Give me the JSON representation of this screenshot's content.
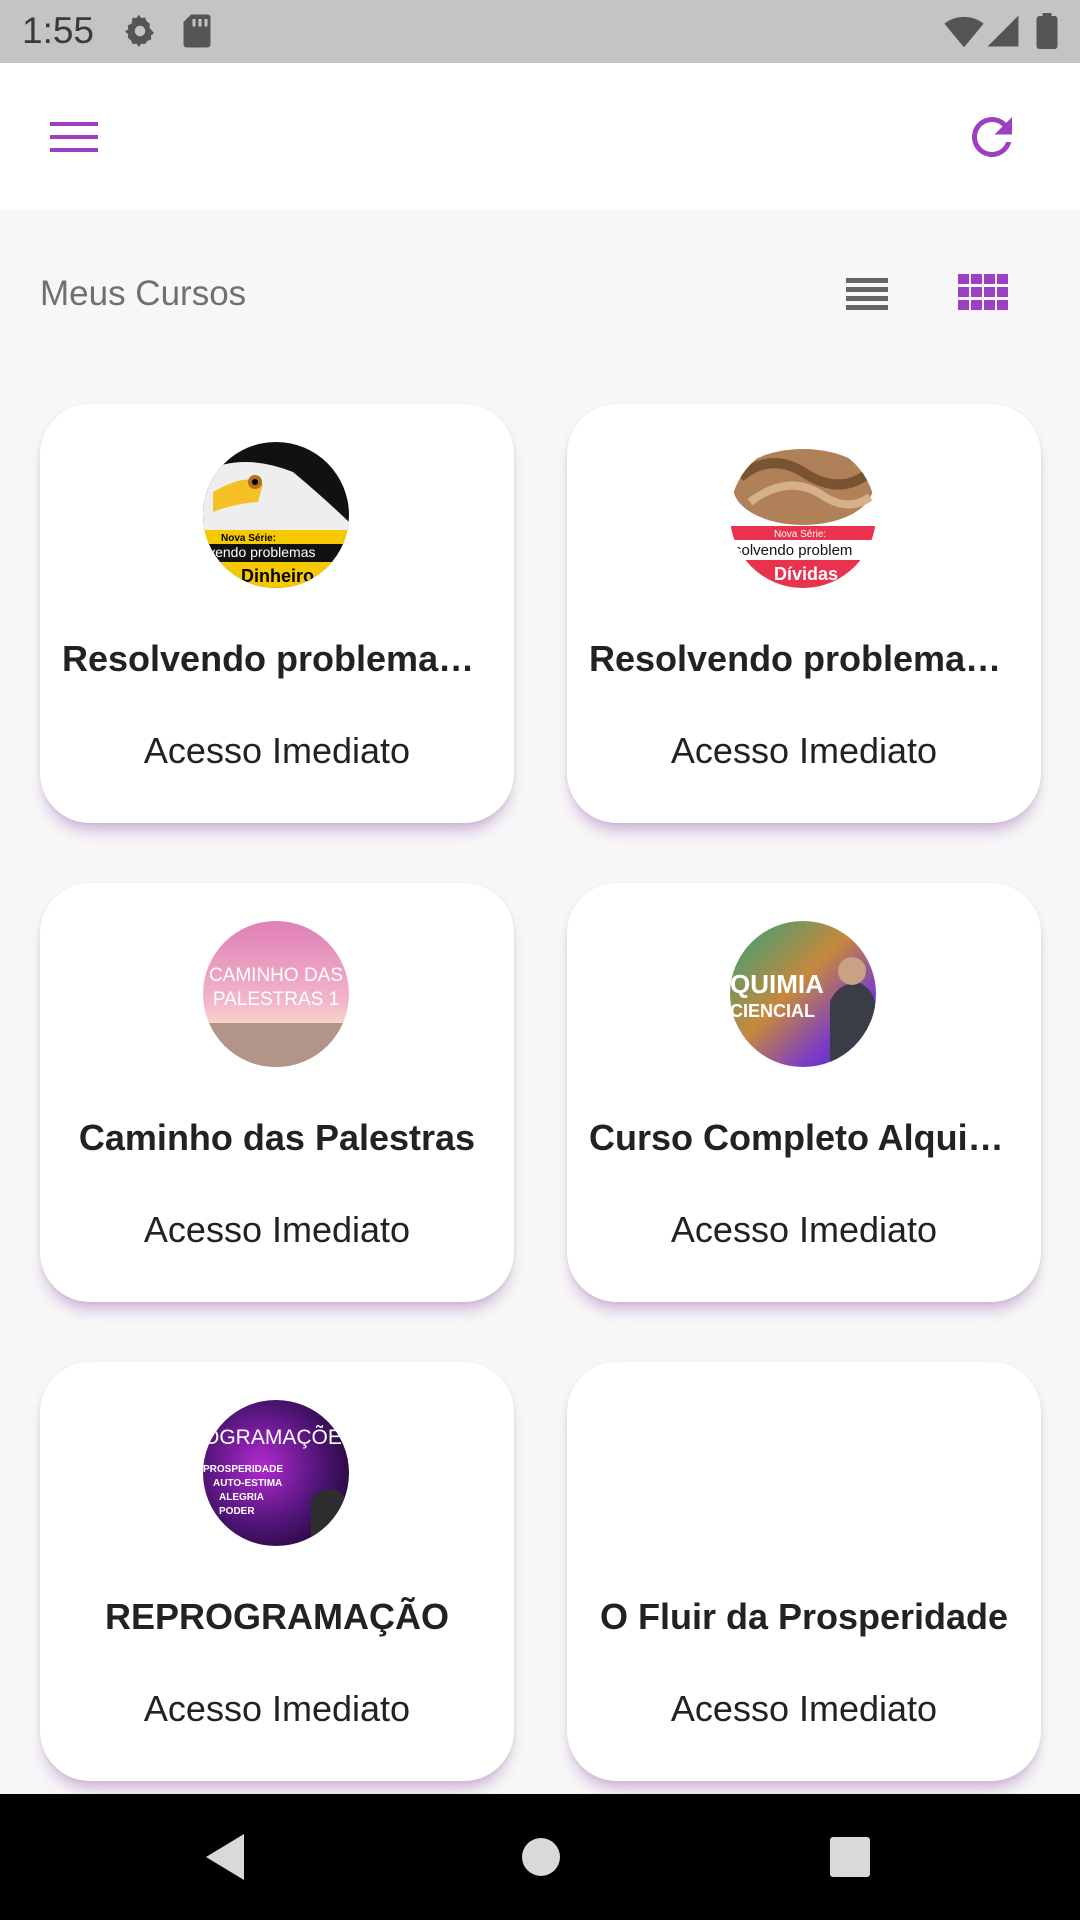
{
  "status_bar": {
    "time": "1:55",
    "icons": [
      "settings-icon",
      "sd-card-icon",
      "wifi-icon",
      "signal-icon",
      "battery-icon"
    ]
  },
  "app_bar": {
    "menu_icon": "hamburger-menu-icon",
    "refresh_icon": "refresh-icon",
    "accent_color": "#9c3fc3"
  },
  "section": {
    "title": "Meus Cursos",
    "view_toggle": [
      "list-view-icon",
      "grid-view-icon"
    ],
    "active_view": "grid"
  },
  "courses": [
    {
      "title": "Resolvendo problemas - Dinheiro",
      "subtitle": "Acesso Imediato",
      "thumb_series": "Nova Série:",
      "thumb_line1": "lvendo problemas",
      "thumb_line2": "Dinheiro"
    },
    {
      "title": "Resolvendo problemas - Dívidas",
      "subtitle": "Acesso Imediato",
      "thumb_series": "Nova Série:",
      "thumb_line1": "solvendo problem",
      "thumb_line2": "Dívidas"
    },
    {
      "title": "Caminho das Palestras",
      "subtitle": "Acesso Imediato",
      "thumb_line1": "CAMINHO DAS",
      "thumb_line2": "PALESTRAS 1"
    },
    {
      "title": "Curso Completo Alquimia",
      "subtitle": "Acesso Imediato",
      "thumb_line1": "QUIMIA",
      "thumb_line2": "CIENCIAL"
    },
    {
      "title": "REPROGRAMAÇÃO",
      "subtitle": "Acesso Imediato",
      "thumb_line1": "OGRAMAÇÕES",
      "thumb_list": [
        "PROSPERIDADE",
        "AUTO-ESTIMA",
        "ALEGRIA",
        "PODER"
      ]
    },
    {
      "title": "O Fluir da Prosperidade",
      "subtitle": "Acesso Imediato"
    }
  ],
  "nav_bar": {
    "icons": [
      "back-icon",
      "home-icon",
      "recents-icon"
    ]
  }
}
